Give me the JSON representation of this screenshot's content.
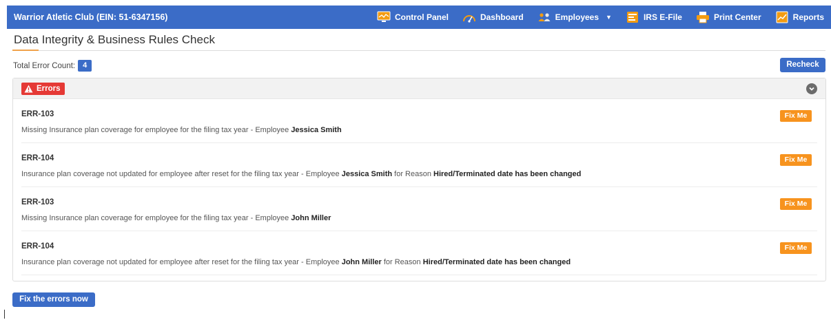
{
  "header": {
    "brand": "Warrior Atletic Club (EIN: 51-6347156)",
    "nav": [
      {
        "label": "Control Panel",
        "icon": "monitor-icon"
      },
      {
        "label": "Dashboard",
        "icon": "gauge-icon"
      },
      {
        "label": "Employees",
        "icon": "people-icon",
        "dropdown": true
      },
      {
        "label": "IRS E-File",
        "icon": "efile-icon"
      },
      {
        "label": "Print Center",
        "icon": "printer-icon"
      },
      {
        "label": "Reports",
        "icon": "report-icon"
      }
    ],
    "caret": "▼"
  },
  "page": {
    "title": "Data Integrity & Business Rules Check",
    "total_label": "Total Error Count:",
    "total_count": "4",
    "recheck_label": "Recheck"
  },
  "errors_panel": {
    "label": "Errors",
    "items": [
      {
        "code": "ERR-103",
        "msg_prefix": "Missing Insurance plan coverage for employee for the filing tax year - Employee ",
        "employee": "Jessica Smith",
        "reason_prefix": "",
        "reason": "",
        "action": "Fix Me"
      },
      {
        "code": "ERR-104",
        "msg_prefix": "Insurance plan coverage not updated for employee after reset for the filing tax year - Employee ",
        "employee": "Jessica Smith",
        "reason_prefix": " for Reason ",
        "reason": "Hired/Terminated date has been changed",
        "action": "Fix Me"
      },
      {
        "code": "ERR-103",
        "msg_prefix": "Missing Insurance plan coverage for employee for the filing tax year - Employee ",
        "employee": "John Miller",
        "reason_prefix": "",
        "reason": "",
        "action": "Fix Me"
      },
      {
        "code": "ERR-104",
        "msg_prefix": "Insurance plan coverage not updated for employee after reset for the filing tax year - Employee ",
        "employee": "John Miller",
        "reason_prefix": " for Reason ",
        "reason": "Hired/Terminated date has been changed",
        "action": "Fix Me"
      }
    ]
  },
  "footer": {
    "fix_all_label": "Fix the errors now"
  },
  "colors": {
    "primary": "#3b6cc7",
    "error": "#e53935",
    "fix": "#f7931e",
    "accent": "#f0a24a"
  }
}
